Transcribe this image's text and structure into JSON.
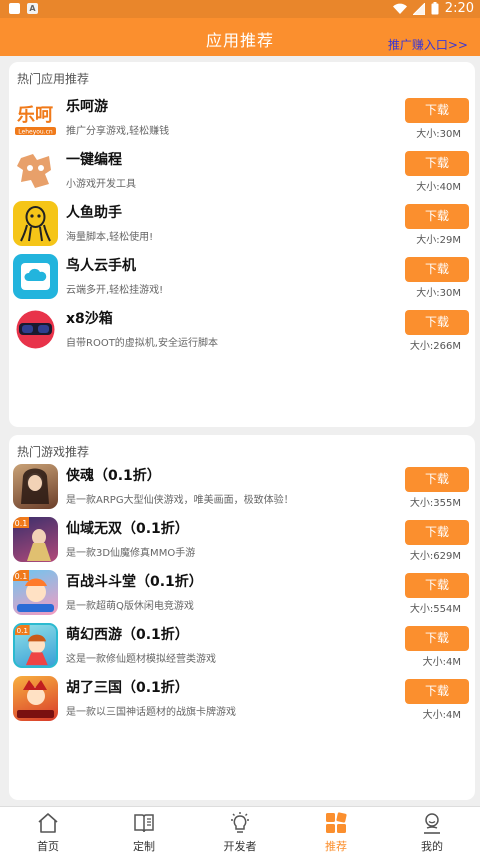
{
  "status_bar": {
    "time": "2:20",
    "notif_badge": "A"
  },
  "header": {
    "title": "应用推荐",
    "promo_link": "推广赚入口>>"
  },
  "apps_section": {
    "title": "热门应用推荐",
    "items": [
      {
        "name": "乐呵游",
        "desc": "推广分享游戏,轻松赚钱",
        "button": "下载",
        "size": "大小:30M",
        "icon": "lehe-logo-icon",
        "logo_text": "乐呵",
        "logo_sub": "Leheyou.cn"
      },
      {
        "name": "一键编程",
        "desc": "小游戏开发工具",
        "button": "下载",
        "size": "大小:40M",
        "icon": "puzzle-icon"
      },
      {
        "name": "人鱼助手",
        "desc": "海量脚本,轻松使用!",
        "button": "下载",
        "size": "大小:29M",
        "icon": "mermaid-icon"
      },
      {
        "name": "鸟人云手机",
        "desc": "云端多开,轻松挂游戏!",
        "button": "下载",
        "size": "大小:30M",
        "icon": "cloud-phone-icon"
      },
      {
        "name": "x8沙箱",
        "desc": "自带ROOT的虚拟机,安全运行脚本",
        "button": "下载",
        "size": "大小:266M",
        "icon": "x8-sandbox-icon"
      }
    ]
  },
  "games_section": {
    "title": "热门游戏推荐",
    "items": [
      {
        "name": "侠魂（0.1折）",
        "desc": "是一款ARPG大型仙侠游戏，唯美画面，极致体验！",
        "button": "下载",
        "size": "大小:355M",
        "icon": "xiahun-game-icon"
      },
      {
        "name": "仙域无双（0.1折）",
        "desc": "是一款3D仙魔修真MMO手游",
        "button": "下载",
        "size": "大小:629M",
        "icon": "xianyu-game-icon",
        "badge": "0.1"
      },
      {
        "name": "百战斗斗堂（0.1折）",
        "desc": "是一款超萌Q版休闲电竞游戏",
        "button": "下载",
        "size": "大小:554M",
        "icon": "baizhan-game-icon",
        "badge": "0.1"
      },
      {
        "name": "萌幻西游（0.1折）",
        "desc": "这是一款修仙题材模拟经营类游戏",
        "button": "下载",
        "size": "大小:4M",
        "icon": "menghuan-game-icon",
        "badge": "0.1"
      },
      {
        "name": "胡了三国（0.1折）",
        "desc": "是一款以三国神话题材的战旗卡牌游戏",
        "button": "下载",
        "size": "大小:4M",
        "icon": "hule-game-icon"
      }
    ]
  },
  "tabbar": {
    "active": 3,
    "tabs": [
      {
        "label": "首页",
        "icon": "home-icon"
      },
      {
        "label": "定制",
        "icon": "book-icon"
      },
      {
        "label": "开发者",
        "icon": "lightbulb-icon"
      },
      {
        "label": "推荐",
        "icon": "grid-icon"
      },
      {
        "label": "我的",
        "icon": "user-icon"
      }
    ]
  },
  "colors": {
    "accent": "#fb8f2e",
    "promo": "#3a37d6",
    "background": "#efefef"
  }
}
